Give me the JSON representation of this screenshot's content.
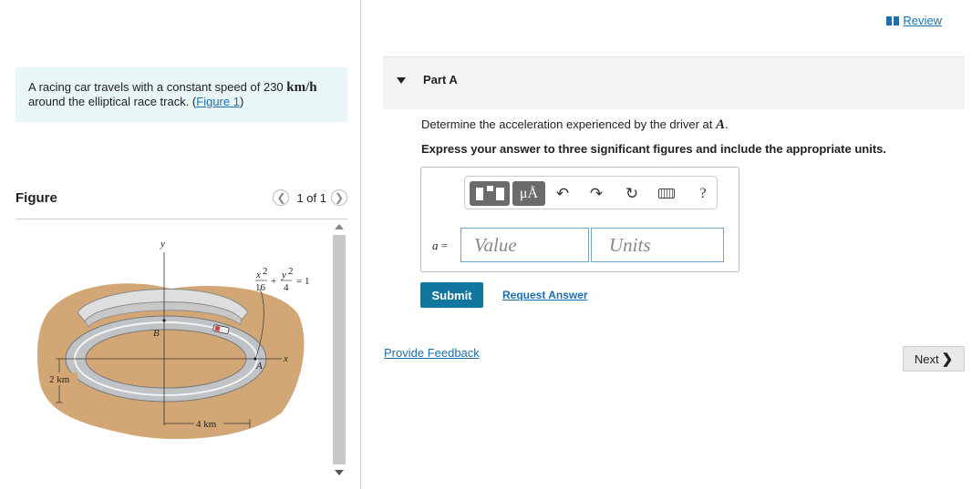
{
  "problem": {
    "text_before": "A racing car travels with a constant speed of 230 ",
    "speed_unit": "km/h",
    "text_after": "around the elliptical race track. (",
    "figure_link": "Figure 1",
    "close_paren": ")"
  },
  "figure": {
    "title": "Figure",
    "page_count": "1 of 1",
    "labels": {
      "y": "y",
      "x": "x",
      "B": "B",
      "A": "A",
      "width": "4 km",
      "height": "2 km",
      "eq_x_num": "x",
      "eq_x_sq": "2",
      "eq_x_den": "16",
      "eq_plus": "+",
      "eq_y_num": "y",
      "eq_y_sq": "2",
      "eq_y_den": "4",
      "eq_equals": "= 1"
    }
  },
  "review": "Review",
  "part": {
    "label": "Part A",
    "question_before": "Determine the acceleration experienced by the driver at ",
    "point": "A",
    "question_after": ".",
    "instruction": "Express your answer to three significant figures and include the appropriate units."
  },
  "toolbar": {
    "units_label": "μÅ",
    "help": "?"
  },
  "answer": {
    "var": "a",
    "equals": " =",
    "value_placeholder": "Value",
    "units_placeholder": "Units"
  },
  "buttons": {
    "submit": "Submit",
    "request": "Request Answer",
    "feedback": "Provide Feedback",
    "next": "Next",
    "next_arrow": "❯"
  },
  "colors": {
    "submit_bg": "#11779e",
    "link": "#1c6fb0",
    "problem_bg": "#e8f6f8",
    "terrain": "#d2a775",
    "track": "#bfc3c6"
  },
  "icons": [
    "book-icon",
    "template-icon",
    "units-icon",
    "undo-icon",
    "redo-icon",
    "reset-icon",
    "keyboard-icon",
    "help-icon",
    "chevron-left-icon",
    "chevron-right-icon"
  ]
}
